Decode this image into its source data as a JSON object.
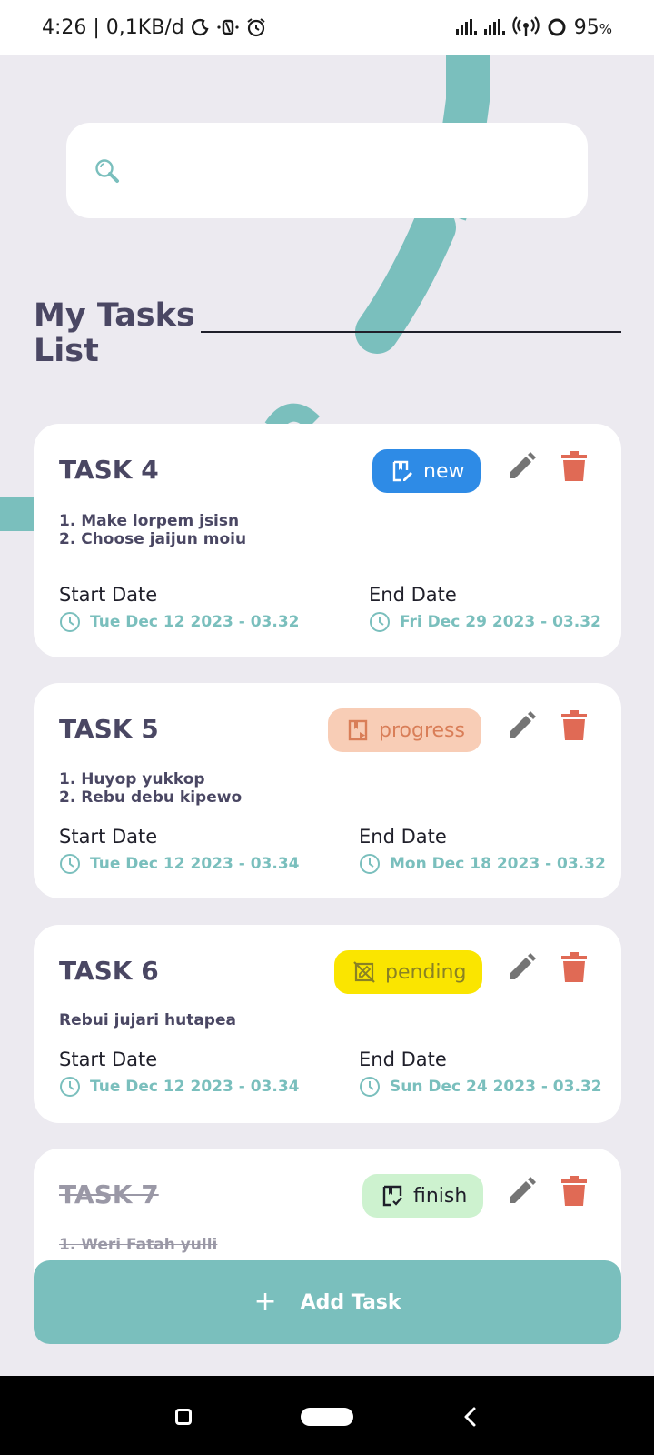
{
  "status_bar": {
    "time_text": "4:26 | 0,1KB/d",
    "battery": "95",
    "battery_unit": "%",
    "icons": [
      "moon-icon",
      "nfc-icon",
      "alarm-icon",
      "signal-icon",
      "signal-icon",
      "hotspot-icon",
      "battery-ring-icon"
    ]
  },
  "search": {
    "placeholder": "",
    "icon": "search-icon"
  },
  "heading": {
    "title": "My Tasks List"
  },
  "tasks": [
    {
      "title": "TASK 4",
      "status": "new",
      "status_icon": "pencil-note-icon",
      "finished": false,
      "description": [
        "1. Make lorpem jsisn",
        "2. Choose jaijun moiu"
      ],
      "start_label": "Start Date",
      "start_date": "Tue Dec 12 2023 - 03.32",
      "end_label": "End Date",
      "end_date": "Fri Dec 29 2023 - 03.32"
    },
    {
      "title": "TASK 5",
      "status": "progress",
      "status_icon": "play-note-icon",
      "finished": false,
      "description": [
        "1. Huyop yukkop",
        "2. Rebu debu kipewo"
      ],
      "start_label": "Start Date",
      "start_date": "Tue Dec 12 2023 - 03.34",
      "end_label": "End Date",
      "end_date": "Mon Dec 18 2023 - 03.32"
    },
    {
      "title": "TASK 6",
      "status": "pending",
      "status_icon": "edit-off-icon",
      "finished": false,
      "description": [
        "Rebui jujari hutapea"
      ],
      "start_label": "Start Date",
      "start_date": "Tue Dec 12 2023 - 03.34",
      "end_label": "End Date",
      "end_date": "Sun Dec 24 2023 - 03.32"
    },
    {
      "title": "TASK 7",
      "status": "finish",
      "status_icon": "check-note-icon",
      "finished": true,
      "description": [
        "1. Weri Fatah yulli"
      ]
    }
  ],
  "add_button": {
    "label": "Add Task",
    "icon": "plus-icon"
  },
  "colors": {
    "accent": "#7ABFBD",
    "background": "#ECEAF0",
    "text": "#4A4763",
    "new": "#2E8BE6",
    "progress": "#F8CDB6",
    "pending": "#FAE500",
    "finish": "#CDF2CF",
    "delete": "#E06A55",
    "edit": "#757575"
  }
}
